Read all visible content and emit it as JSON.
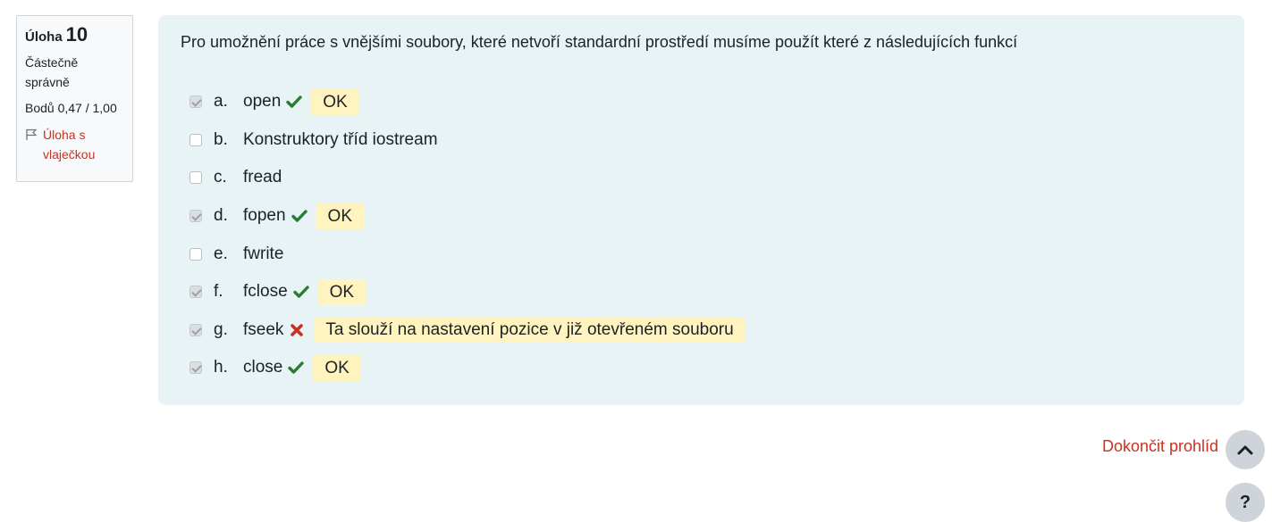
{
  "info": {
    "question_label": "Úloha",
    "question_number": "10",
    "state": "Částečně správně",
    "grade": "Bodů 0,47 / 1,00",
    "flag_label": "Úloha s vlaječkou",
    "flag_icon": "flag-icon"
  },
  "question": {
    "text": "Pro umožnění práce s vnějšími soubory, které netvoří standardní prostředí musíme použít které z následujících funkcí",
    "answers": [
      {
        "letter": "a.",
        "text": "open",
        "checked": true,
        "mark": "correct",
        "feedback": "OK"
      },
      {
        "letter": "b.",
        "text": "Konstruktory tříd iostream",
        "checked": false,
        "mark": "",
        "feedback": ""
      },
      {
        "letter": "c.",
        "text": "fread",
        "checked": false,
        "mark": "",
        "feedback": ""
      },
      {
        "letter": "d.",
        "text": "fopen",
        "checked": true,
        "mark": "correct",
        "feedback": "OK"
      },
      {
        "letter": "e.",
        "text": "fwrite",
        "checked": false,
        "mark": "",
        "feedback": ""
      },
      {
        "letter": "f.",
        "text": "fclose",
        "checked": true,
        "mark": "correct",
        "feedback": "OK"
      },
      {
        "letter": "g.",
        "text": "fseek",
        "checked": true,
        "mark": "incorrect",
        "feedback": "Ta slouží na nastavení pozice v již otevřeném souboru"
      },
      {
        "letter": "h.",
        "text": "close",
        "checked": true,
        "mark": "correct",
        "feedback": "OK"
      }
    ]
  },
  "footer": {
    "finish_link": "Dokončit prohlíd",
    "scroll_up_icon": "chevron-up-icon",
    "help_label": "?"
  },
  "colors": {
    "correct": "#2b7a36",
    "incorrect": "#ca3120",
    "feedback_bg": "#fff3bf",
    "panel_bg": "#e7f3f5",
    "link": "#ca3120"
  }
}
